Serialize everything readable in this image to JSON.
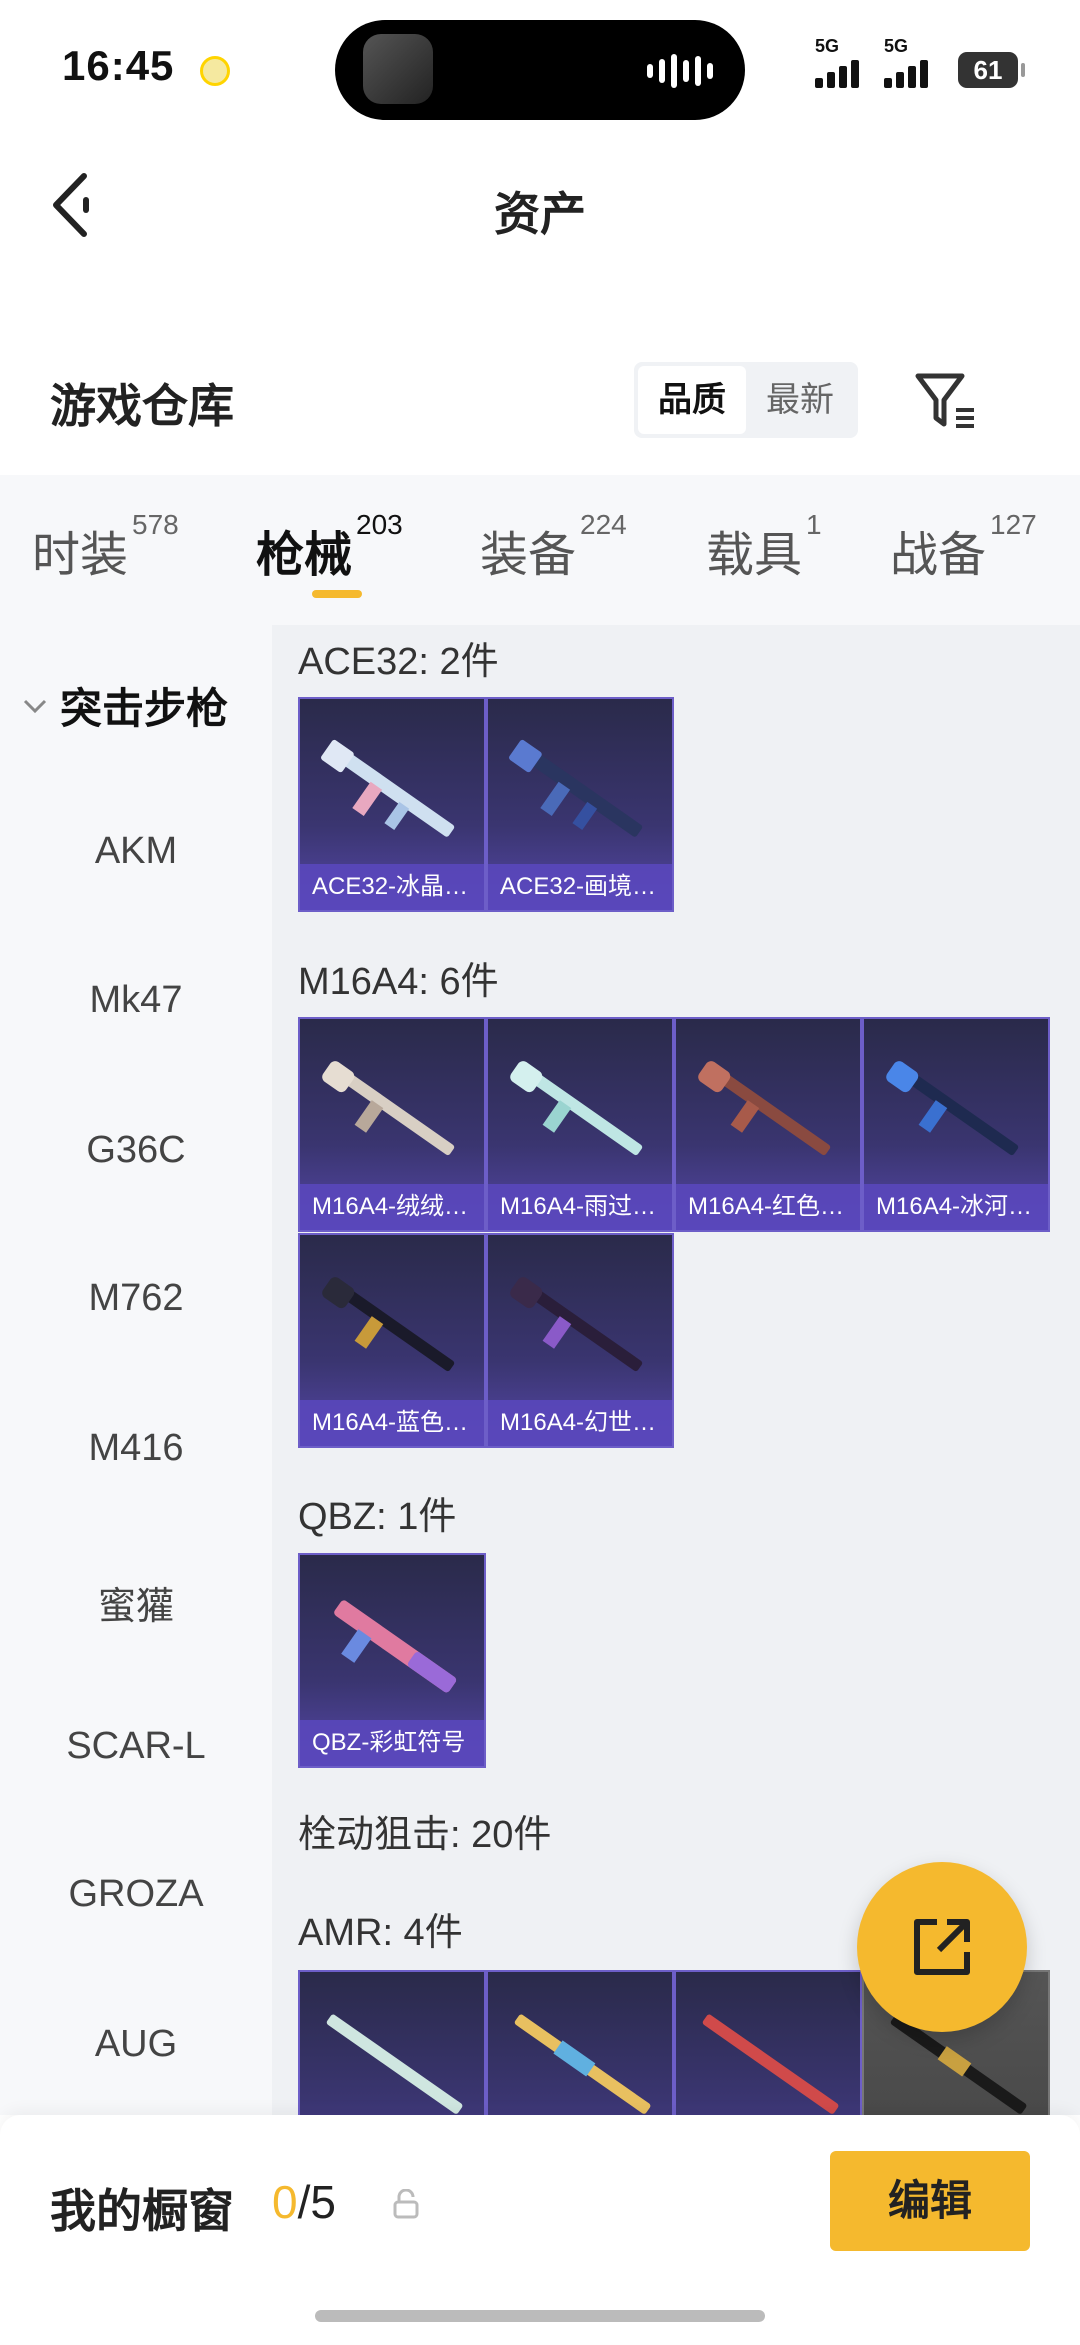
{
  "status_bar": {
    "time": "16:45",
    "signal_1": "5G",
    "signal_2": "5G",
    "battery": "61"
  },
  "header": {
    "title": "资产",
    "back_icon": "chevron-left-icon"
  },
  "warehouse": {
    "title": "游戏仓库",
    "sort_options": [
      "品质",
      "最新"
    ],
    "sort_selected": "品质",
    "filter_icon": "filter-icon"
  },
  "tabs": [
    {
      "label": "时装",
      "count": "578"
    },
    {
      "label": "枪械",
      "count": "203"
    },
    {
      "label": "装备",
      "count": "224"
    },
    {
      "label": "载具",
      "count": "1"
    },
    {
      "label": "战备",
      "count": "127"
    }
  ],
  "active_tab": "枪械",
  "sidebar": {
    "group": "突击步枪",
    "items": [
      "AKM",
      "Mk47",
      "G36C",
      "M762",
      "M416",
      "蜜獾",
      "SCAR-L",
      "GROZA",
      "AUG"
    ]
  },
  "groups": [
    {
      "label": "ACE32: 2件",
      "items": [
        "ACE32-冰晶…",
        "ACE32-画境…"
      ]
    },
    {
      "label": "M16A4: 6件",
      "items": [
        "M16A4-绒绒…",
        "M16A4-雨过…",
        "M16A4-红色…",
        "M16A4-冰河…",
        "M16A4-蓝色…",
        "M16A4-幻世…"
      ]
    },
    {
      "label": "QBZ: 1件",
      "items": [
        "QBZ-彩虹符号"
      ]
    },
    {
      "label": "栓动狙击: 20件",
      "items": []
    },
    {
      "label": "AMR: 4件",
      "items": []
    }
  ],
  "showcase": {
    "label": "我的橱窗",
    "current": "0",
    "total": "/5",
    "edit_label": "编辑"
  },
  "colors": {
    "accent": "#f5b92e",
    "card_purple": "#3a3570"
  }
}
